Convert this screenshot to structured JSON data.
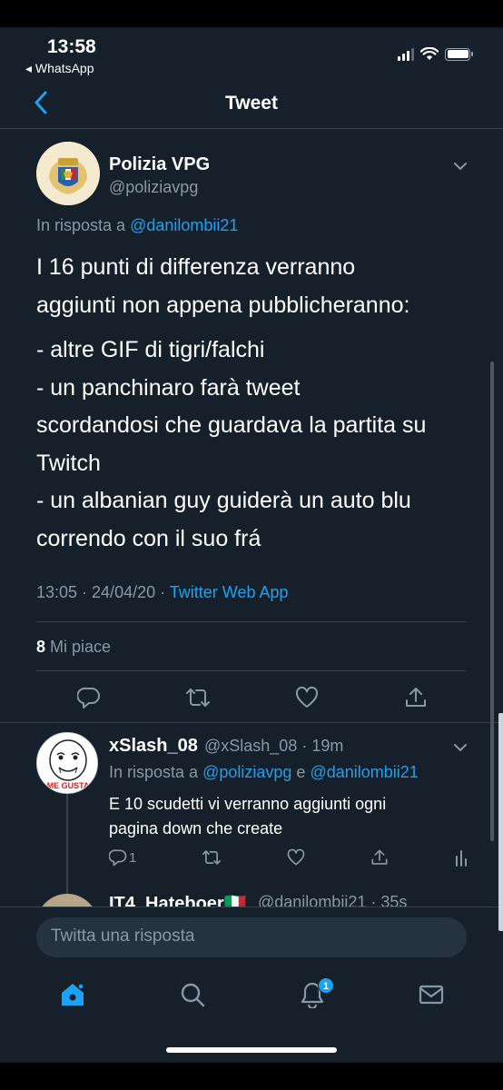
{
  "status_bar": {
    "time": "13:58",
    "back_app": "◂ WhatsApp"
  },
  "header": {
    "title": "Tweet"
  },
  "tweet": {
    "author_name": "Polizia VPG",
    "author_handle": "@poliziavpg",
    "reply_prefix": "In risposta a",
    "reply_to": "@danilombii21",
    "lines": [
      "I 16 punti di differenza verranno",
      "aggiunti non appena pubblicheranno:",
      "- altre GIF di tigri/falchi",
      "- un panchinaro farà tweet",
      "scordandosi che guardava la partita su",
      "Twitch",
      "- un albanian guy guiderà un auto blu",
      "correndo con il suo frá"
    ],
    "time_date": "13:05 · 24/04/20 ·",
    "source": "Twitter Web App",
    "likes_count": "8",
    "likes_label": "Mi piace"
  },
  "reply": {
    "author_name": "xSlash_08",
    "meta": "@xSlash_08 · 19m",
    "reply_prefix": "In risposta a",
    "reply_to_1": "@poliziavpg",
    "reply_conj": "e",
    "reply_to_2": "@danilombii21",
    "text_line_1": "E 10 scudetti vi verranno aggiunti ogni",
    "text_line_2": "pagina down che create",
    "reply_count": "1",
    "avatar_text": "ME GUSTA"
  },
  "next_reply": {
    "author_name": "IT4_Hateboer🇮🇹",
    "meta": "@danilombii21 · 35s"
  },
  "compose": {
    "placeholder": "Twitta una risposta"
  },
  "tabbar": {
    "notifications_badge": "1"
  },
  "colors": {
    "background": "#15202b",
    "accent": "#1da1f2",
    "muted": "#8899a6",
    "divider": "#38444d"
  },
  "icons": [
    "chevron-left-icon",
    "chevron-down-icon",
    "reply-icon",
    "retweet-icon",
    "like-icon",
    "share-icon",
    "analytics-icon",
    "home-icon",
    "search-icon",
    "bell-icon",
    "mail-icon"
  ]
}
